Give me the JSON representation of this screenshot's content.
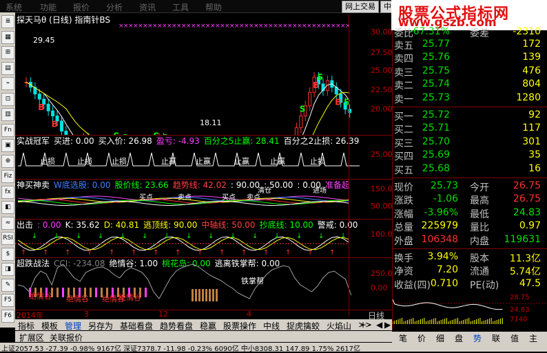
{
  "menu": [
    "系统",
    "功能",
    "报价",
    "分析",
    "资讯",
    "工具",
    "帮助"
  ],
  "top_buttons": {
    "trade": "网上交易",
    "extra": "中"
  },
  "logo": {
    "line1": "股票公式指标网",
    "line2": "www.gszb.com"
  },
  "left_toolbar": [
    "≣",
    "▦",
    "⊞",
    "▤",
    "⌁",
    "⊡",
    "▥",
    "Fn",
    "▣",
    "⊕",
    "Fiz",
    "fx",
    "◧",
    "≈",
    "RSI",
    "$",
    "◨",
    "✎",
    "F5",
    "F6"
  ],
  "main_pane": {
    "title": "探天马θ (日线) 指南针BS",
    "high_label": "29.45",
    "low_label": "18.11",
    "y_ticks": [
      "30.00",
      "27.50",
      "25.00",
      "22.50",
      "20.00"
    ]
  },
  "pane2": {
    "label": "实战冠军",
    "items": [
      {
        "text": "买进: 0.00",
        "color": "#ffffff"
      },
      {
        "text": "买入价: 26.98",
        "color": "#ffffff"
      },
      {
        "text": "盈亏: -4.93",
        "color": "#ff40ff"
      },
      {
        "text": "百分之5止赢: 28.41",
        "color": "#00ff00"
      },
      {
        "text": "百分之2止损: 26.39",
        "color": "#ffffff"
      }
    ],
    "y_ticks": [
      "25.00"
    ],
    "marks": [
      "止损",
      "止损",
      "止损",
      "止赢",
      "止赢",
      "止赢",
      "止赢",
      "止损"
    ]
  },
  "pane3": {
    "label": "神买神卖",
    "items": [
      {
        "text": "W底选股: 0.00",
        "color": "#4080ff"
      },
      {
        "text": "股价线: 23.66",
        "color": "#00ff00"
      },
      {
        "text": "趋势线: 42.02",
        "color": "#ff4040"
      },
      {
        "text": ": 90.00",
        "color": "#ffffff"
      },
      {
        "text": ": 50.00",
        "color": "#ffffff"
      },
      {
        "text": ": 0.00",
        "color": "#ffffff"
      },
      {
        "text": "准备超",
        "color": "#ff40ff"
      }
    ],
    "y_ticks": [
      "150.00",
      "50.00"
    ],
    "marks": [
      "买点",
      "卖点",
      "买点",
      "卖点",
      "清仓",
      "进场"
    ]
  },
  "pane4": {
    "label": "出击",
    "items": [
      {
        "text": ": 0.00",
        "color": "#ff40ff"
      },
      {
        "text": "K: 35.62",
        "color": "#ffffff"
      },
      {
        "text": "D: 40.81",
        "color": "#ffff00"
      },
      {
        "text": "逃顶线: 90.00",
        "color": "#ffff00"
      },
      {
        "text": "中轴线: 50.00",
        "color": "#ff4040"
      },
      {
        "text": "抄底线: 10.00",
        "color": "#00ff00"
      },
      {
        "text": "警戒: 0.00",
        "color": "#ffffff"
      }
    ],
    "y_ticks": [
      "100.00"
    ]
  },
  "pane5": {
    "label": "超跌战法",
    "items": [
      {
        "text": "CCI: -234.08",
        "color": "#808080"
      },
      {
        "text": "绝情谷: 1.00",
        "color": "#ffffff"
      },
      {
        "text": "桃花岛: 0.00",
        "color": "#00ff00"
      },
      {
        "text": "逃离铁掌帮: 0.00",
        "color": "#ffffff"
      }
    ],
    "y_ticks": [
      "250.00",
      "0.00"
    ],
    "marks": [
      "绝情谷",
      "绝情谷",
      "绝情谷",
      "绝情谷",
      "铁掌帮"
    ]
  },
  "x_axis": {
    "labels": [
      "2014年",
      "3",
      "12",
      "4"
    ],
    "period": "日线"
  },
  "tabs": [
    "指标",
    "模板",
    "管理",
    "另存为",
    "基础看盘",
    "趋势看盘",
    "稳赢",
    "股票操作",
    "中线",
    "捉虎擒蛟",
    "火焰山",
    ">>"
  ],
  "tab_controls": [
    "+",
    "-",
    "◀",
    "▶"
  ],
  "bottom_tabs": [
    "扩展区",
    "关联报价"
  ],
  "status_text": "上证2057.53  -27.39  -0.98%  9167亿  深证7378.7  -11.98  -0.23%  6090亿  中小8308.31  147.89  1.75%  2617亿",
  "quote": {
    "top_row": {
      "l": "委比",
      "v": "-67.31%",
      "l2": "委差",
      "v2": "-2310"
    },
    "sell": [
      {
        "l": "卖五",
        "p": "25.77",
        "v": "172"
      },
      {
        "l": "卖四",
        "p": "25.76",
        "v": "139"
      },
      {
        "l": "卖三",
        "p": "25.75",
        "v": "476"
      },
      {
        "l": "卖二",
        "p": "25.74",
        "v": "804"
      },
      {
        "l": "卖一",
        "p": "25.73",
        "v": "1280"
      }
    ],
    "buy": [
      {
        "l": "买一",
        "p": "25.72",
        "v": "92"
      },
      {
        "l": "买二",
        "p": "25.71",
        "v": "117"
      },
      {
        "l": "买三",
        "p": "25.70",
        "v": "301"
      },
      {
        "l": "买四",
        "p": "25.69",
        "v": "35"
      },
      {
        "l": "买五",
        "p": "25.68",
        "v": "16"
      }
    ],
    "stats": [
      {
        "l": "现价",
        "v": "25.73",
        "c": "grn",
        "l2": "今开",
        "v2": "26.75",
        "c2": "red"
      },
      {
        "l": "涨跌",
        "v": "-1.06",
        "c": "grn",
        "l2": "最高",
        "v2": "26.75",
        "c2": "red"
      },
      {
        "l": "涨幅",
        "v": "-3.96%",
        "c": "grn",
        "l2": "最低",
        "v2": "24.83",
        "c2": "grn"
      },
      {
        "l": "总量",
        "v": "225979",
        "c": "yel",
        "l2": "量比",
        "v2": "0.97",
        "c2": "yel"
      },
      {
        "l": "外盘",
        "v": "106348",
        "c": "red",
        "l2": "内盘",
        "v2": "119631",
        "c2": "grn"
      }
    ],
    "stats2": [
      {
        "l": "换手",
        "v": "3.94%",
        "l2": "股本",
        "v2": "11.3亿"
      },
      {
        "l": "净资",
        "v": "7.20",
        "l2": "流通",
        "v2": "5.74亿"
      },
      {
        "l": "收益(四)",
        "v": "0.710",
        "l2": "PE(动)",
        "v2": "47.5"
      }
    ],
    "mini": {
      "hi": "28.75",
      "lo": "24.83",
      "vol": "7140"
    }
  },
  "right_tabs": [
    "笔",
    "价",
    "细",
    "盘",
    "势",
    "联",
    "值",
    "主"
  ]
}
